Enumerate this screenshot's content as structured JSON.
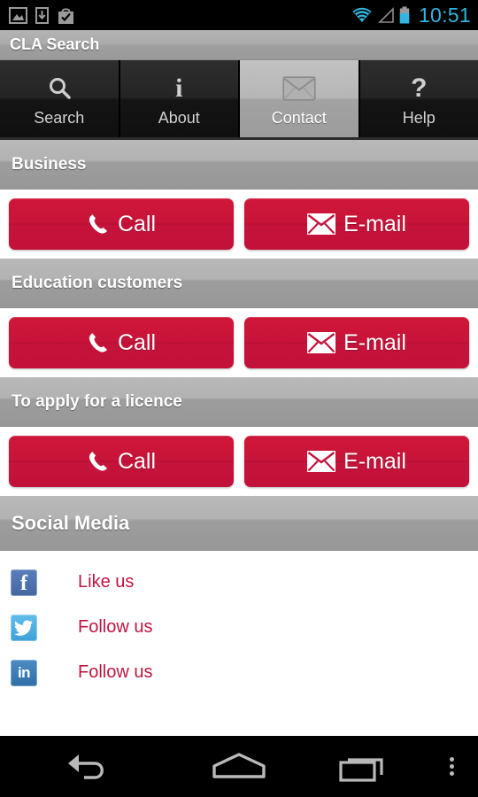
{
  "statusbar": {
    "icons": [
      "image-icon",
      "download-icon",
      "play-store-bag-icon"
    ],
    "right_icons": [
      "wifi-icon",
      "signal-icon",
      "battery-icon"
    ],
    "clock": "10:51",
    "clock_color": "#30b6e0"
  },
  "titlebar": {
    "title": "CLA Search"
  },
  "tabs": [
    {
      "label": "Search",
      "icon": "search-icon",
      "selected": false
    },
    {
      "label": "About",
      "icon": "info-icon",
      "selected": false
    },
    {
      "label": "Contact",
      "icon": "envelope-icon",
      "selected": true
    },
    {
      "label": "Help",
      "icon": "question-icon",
      "selected": false
    }
  ],
  "sections": [
    {
      "header": "Business",
      "buttons": [
        {
          "label": "Call",
          "icon": "phone-icon"
        },
        {
          "label": "E-mail",
          "icon": "envelope-icon"
        }
      ]
    },
    {
      "header": "Education customers",
      "buttons": [
        {
          "label": "Call",
          "icon": "phone-icon"
        },
        {
          "label": "E-mail",
          "icon": "envelope-icon"
        }
      ]
    },
    {
      "header": "To apply for a licence",
      "buttons": [
        {
          "label": "Call",
          "icon": "phone-icon"
        },
        {
          "label": "E-mail",
          "icon": "envelope-icon"
        }
      ]
    }
  ],
  "social": {
    "header": "Social Media",
    "items": [
      {
        "label": "Like us",
        "icon": "facebook-icon",
        "color": "#4a6eab"
      },
      {
        "label": "Follow us",
        "icon": "twitter-icon",
        "color": "#4fb0e2"
      },
      {
        "label": "Follow us",
        "icon": "linkedin-icon",
        "color": "#3b7cb5"
      }
    ]
  },
  "navbar": {
    "buttons": [
      "back-icon",
      "home-icon",
      "recents-icon",
      "overflow-menu-icon"
    ]
  },
  "colors": {
    "brand_red": "#c8143a",
    "link_red": "#c01540",
    "header_gray": "#aaaaaa",
    "accent_blue": "#30b6e0"
  }
}
